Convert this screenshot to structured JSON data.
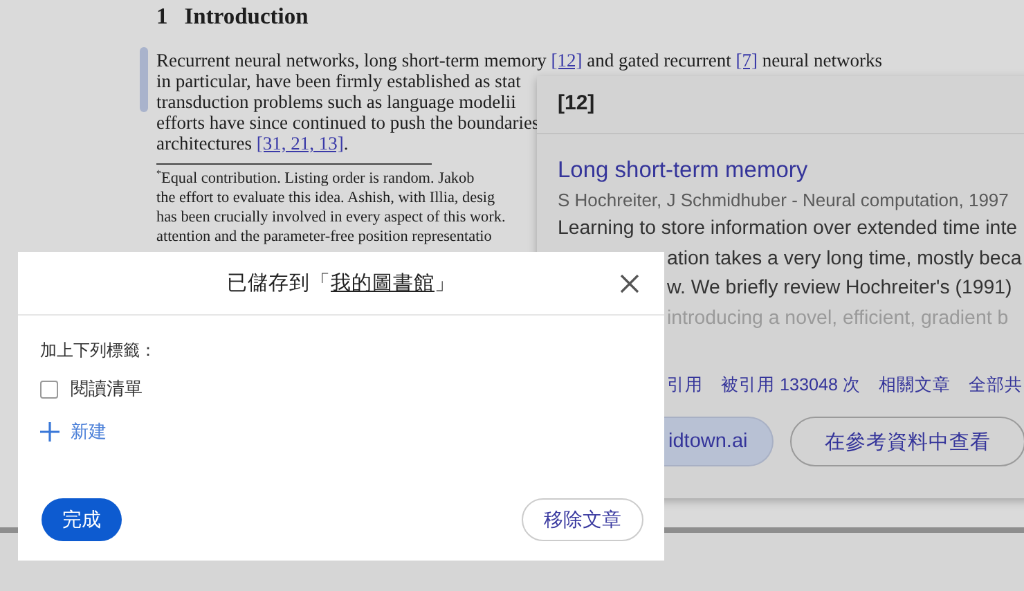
{
  "paper": {
    "heading_number": "1",
    "heading": "Introduction",
    "paragraph_lines": [
      [
        {
          "kind": "text",
          "text": "Recurrent neural networks, long short-term memory "
        },
        {
          "kind": "ref",
          "text": "[12]"
        },
        {
          "kind": "text",
          "text": " and gated recurrent "
        },
        {
          "kind": "ref",
          "text": "[7]"
        },
        {
          "kind": "text",
          "text": " neural networks"
        }
      ],
      [
        {
          "kind": "text",
          "text": "in particular, have been firmly established as stat"
        }
      ],
      [
        {
          "kind": "text",
          "text": "transduction problems such as language modelii"
        }
      ],
      [
        {
          "kind": "text",
          "text": "efforts have since continued to push the boundaries"
        }
      ],
      [
        {
          "kind": "text",
          "text": "architectures "
        },
        {
          "kind": "ref",
          "text": "[31, 21, 13]"
        },
        {
          "kind": "text",
          "text": "."
        }
      ]
    ],
    "footnote_lines": [
      "$^{*}$Equal contribution. Listing order is random. Jakob",
      "the effort to evaluate this idea. Ashish, with Illia, desig",
      "has been crucially involved in every aspect of this work.",
      "attention and the parameter-free position representatio"
    ]
  },
  "citation_popup": {
    "label": "[12]",
    "title": "Long short-term memory",
    "authors": "S Hochreiter, J Schmidhuber - Neural computation, 1997",
    "abstract_lines": [
      {
        "text": "Learning to store information over extended time inte",
        "covered": false
      },
      {
        "text": "ation takes a very long time, mostly beca",
        "covered": true
      },
      {
        "text": "w. We briefly review Hochreiter's (1991)",
        "covered": true
      },
      {
        "text": "introducing a novel, efficient, gradient b",
        "covered": true
      }
    ],
    "links": [
      "引用",
      "被引用 133048 次",
      "相關文章",
      "全部共"
    ],
    "buttons": [
      {
        "label": "idtown.ai",
        "kind": "filled"
      },
      {
        "label": "在參考資料中查看",
        "kind": "outlined"
      }
    ]
  },
  "dialog": {
    "title_prefix": "已儲存到「",
    "library_link": "我的圖書館",
    "title_suffix": "」",
    "labels_prompt": "加上下列標籤：",
    "tags": [
      {
        "label": "閱讀清單",
        "checked": false
      }
    ],
    "new_label": "新建",
    "done_button": "完成",
    "remove_button": "移除文章"
  }
}
